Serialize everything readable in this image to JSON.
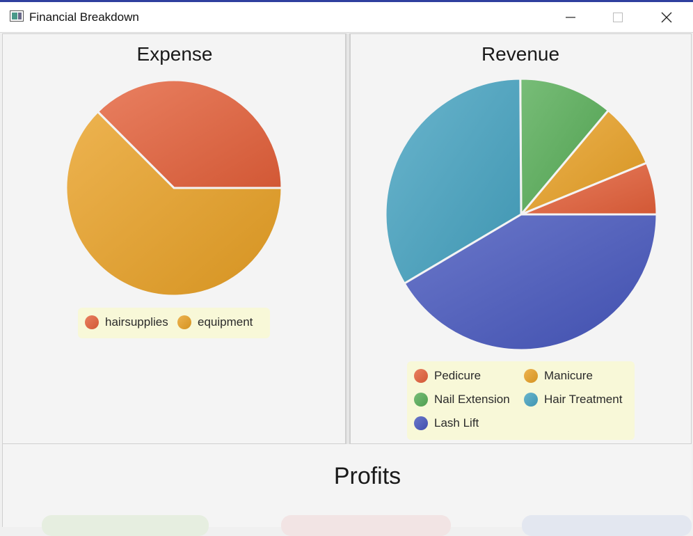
{
  "window": {
    "title": "Financial Breakdown"
  },
  "charts": [
    {
      "type": "pie",
      "title": "Expense",
      "start_angle_deg": 0,
      "slices": [
        {
          "label": "hairsupplies",
          "value": 0.375,
          "color": "#e4603a"
        },
        {
          "label": "equipment",
          "value": 0.625,
          "color": "#e8a024"
        }
      ]
    },
    {
      "type": "pie",
      "title": "Revenue",
      "start_angle_deg": 0,
      "slices": [
        {
          "label": "Pedicure",
          "value": 0.062,
          "color": "#e4603a"
        },
        {
          "label": "Manicure",
          "value": 0.077,
          "color": "#e8a024"
        },
        {
          "label": "Nail Extension",
          "value": 0.112,
          "color": "#56ad56"
        },
        {
          "label": "Hair Treatment",
          "value": 0.334,
          "color": "#45a2c0"
        },
        {
          "label": "Lash Lift",
          "value": 0.415,
          "color": "#4656bd"
        }
      ]
    }
  ],
  "chart_data": [
    {
      "type": "pie",
      "title": "Expense",
      "categories": [
        "hairsupplies",
        "equipment"
      ],
      "values": [
        0.375,
        0.625
      ],
      "legend": "bottom"
    },
    {
      "type": "pie",
      "title": "Revenue",
      "categories": [
        "Pedicure",
        "Manicure",
        "Nail Extension",
        "Hair Treatment",
        "Lash Lift"
      ],
      "values": [
        0.062,
        0.077,
        0.112,
        0.334,
        0.415
      ],
      "legend": "bottom"
    }
  ],
  "profits": {
    "title": "Profits",
    "card_colors": [
      "#e6eee0",
      "#f2e4e4",
      "#e3e7f0"
    ]
  }
}
